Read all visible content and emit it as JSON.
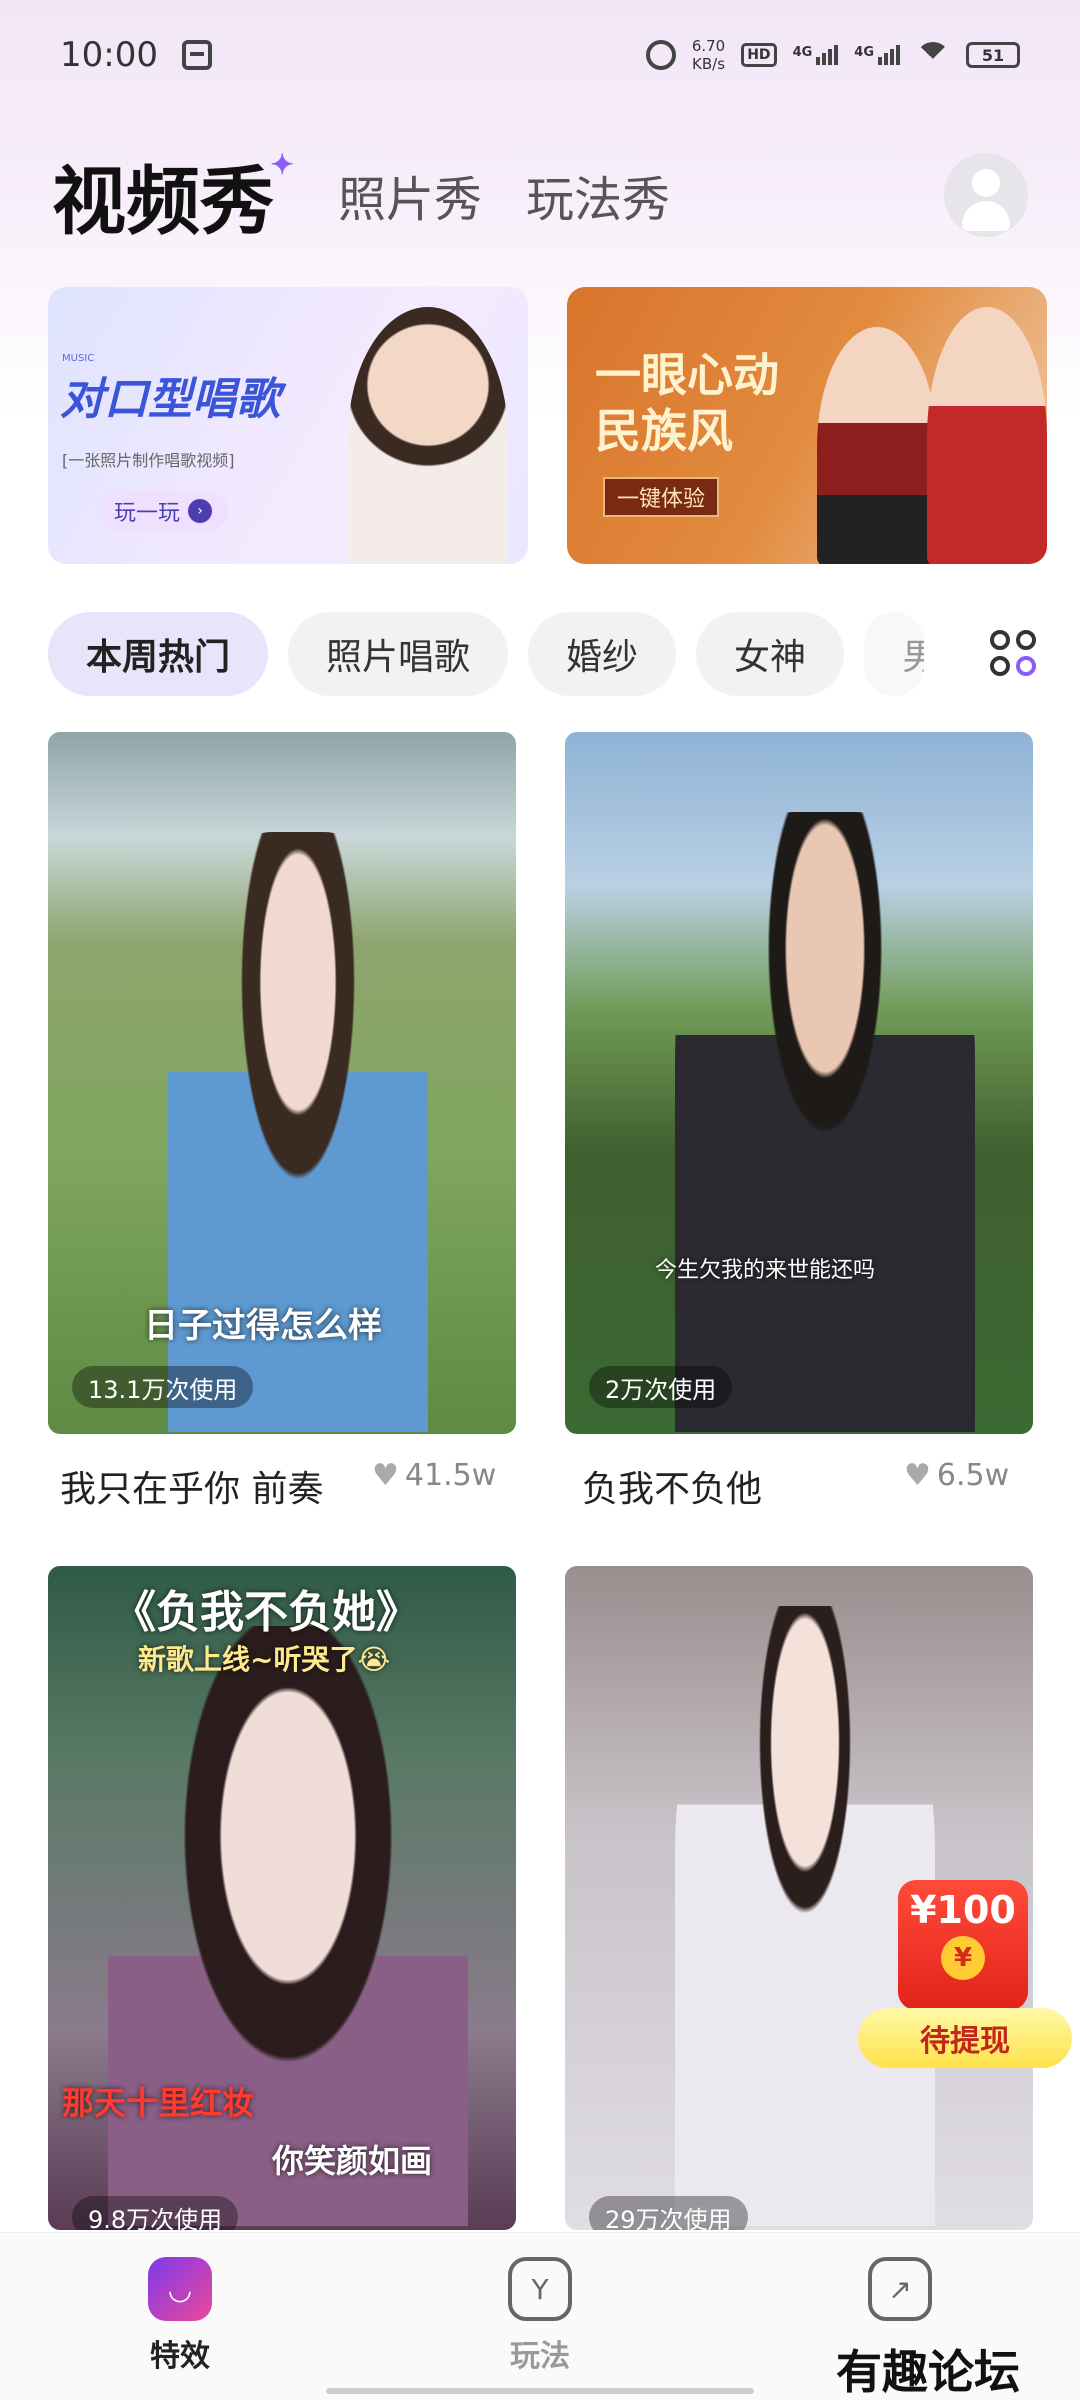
{
  "status": {
    "time": "10:00",
    "speed_value": "6.70",
    "speed_unit": "KB/s",
    "hd": "HD",
    "net1": "4G",
    "net2": "4G",
    "battery": "51"
  },
  "header": {
    "title": "视频秀",
    "tabs": [
      "照片秀",
      "玩法秀"
    ]
  },
  "banners": [
    {
      "small_label": "MUSIC",
      "title": "对口型唱歌",
      "subtitle": "[一张照片制作唱歌视频]",
      "cta": "玩一玩"
    },
    {
      "title": "一眼心动民族风",
      "cta": "一键体验"
    }
  ],
  "chips": [
    "本周热门",
    "照片唱歌",
    "婚纱",
    "女神",
    "男"
  ],
  "cards": [
    {
      "title": "我只在乎你 前奏",
      "likes": "41.5w",
      "usage": "13.1万次使用",
      "lyric": "日子过得怎么样"
    },
    {
      "title": "负我不负他",
      "likes": "6.5w",
      "usage": "2万次使用",
      "lyric": "今生欠我的来世能还吗"
    },
    {
      "usage": "9.8万次使用",
      "lyric_top": "《负我不负她》",
      "lyric_sub": "新歌上线~听哭了😭",
      "lyric_b1": "那天十里红妆",
      "lyric_b2": "你笑颜如画"
    },
    {
      "usage": "29万次使用"
    }
  ],
  "money": {
    "amount": "¥100",
    "coin": "¥",
    "button": "待提现"
  },
  "bottom_nav": [
    {
      "label": "特效",
      "icon": "face-icon",
      "active": true
    },
    {
      "label": "玩法",
      "icon": "shield-icon",
      "active": false
    },
    {
      "label": "",
      "icon": "note-icon",
      "active": false
    }
  ],
  "watermark": "有趣论坛"
}
